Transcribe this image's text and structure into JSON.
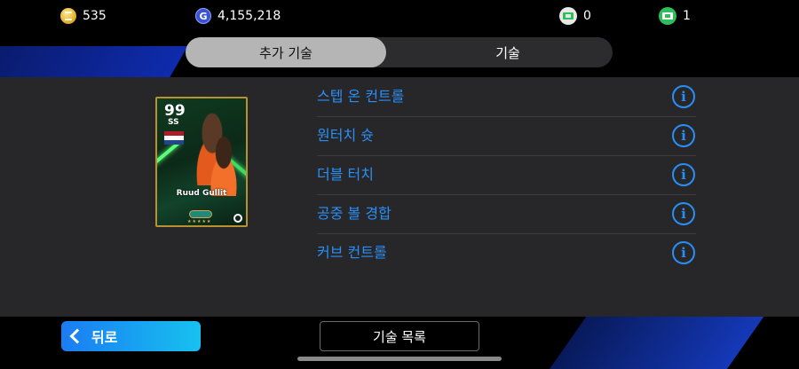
{
  "resources": {
    "coins": "535",
    "gp": "4,155,218",
    "tickets_white": "0",
    "tickets_green": "1"
  },
  "tabs": [
    {
      "label": "추가 기술",
      "active": true
    },
    {
      "label": "기술",
      "active": false
    }
  ],
  "card": {
    "rating": "99",
    "position": "SS",
    "player_name": "Ruud Gullit",
    "flag_colors": [
      "#ae1c28",
      "#ffffff",
      "#21468b"
    ],
    "stars": "★★★★★"
  },
  "skills": [
    {
      "label": "스텝 온 컨트롤"
    },
    {
      "label": "원터치 슛"
    },
    {
      "label": "더블 터치"
    },
    {
      "label": "공중 볼 경합"
    },
    {
      "label": "커브 컨트롤"
    }
  ],
  "info_symbol": "i",
  "bottom": {
    "back_label": "뒤로",
    "skill_list_label": "기술 목록"
  },
  "colors": {
    "accent_blue": "#2a8ff5",
    "panel": "#27272a"
  }
}
